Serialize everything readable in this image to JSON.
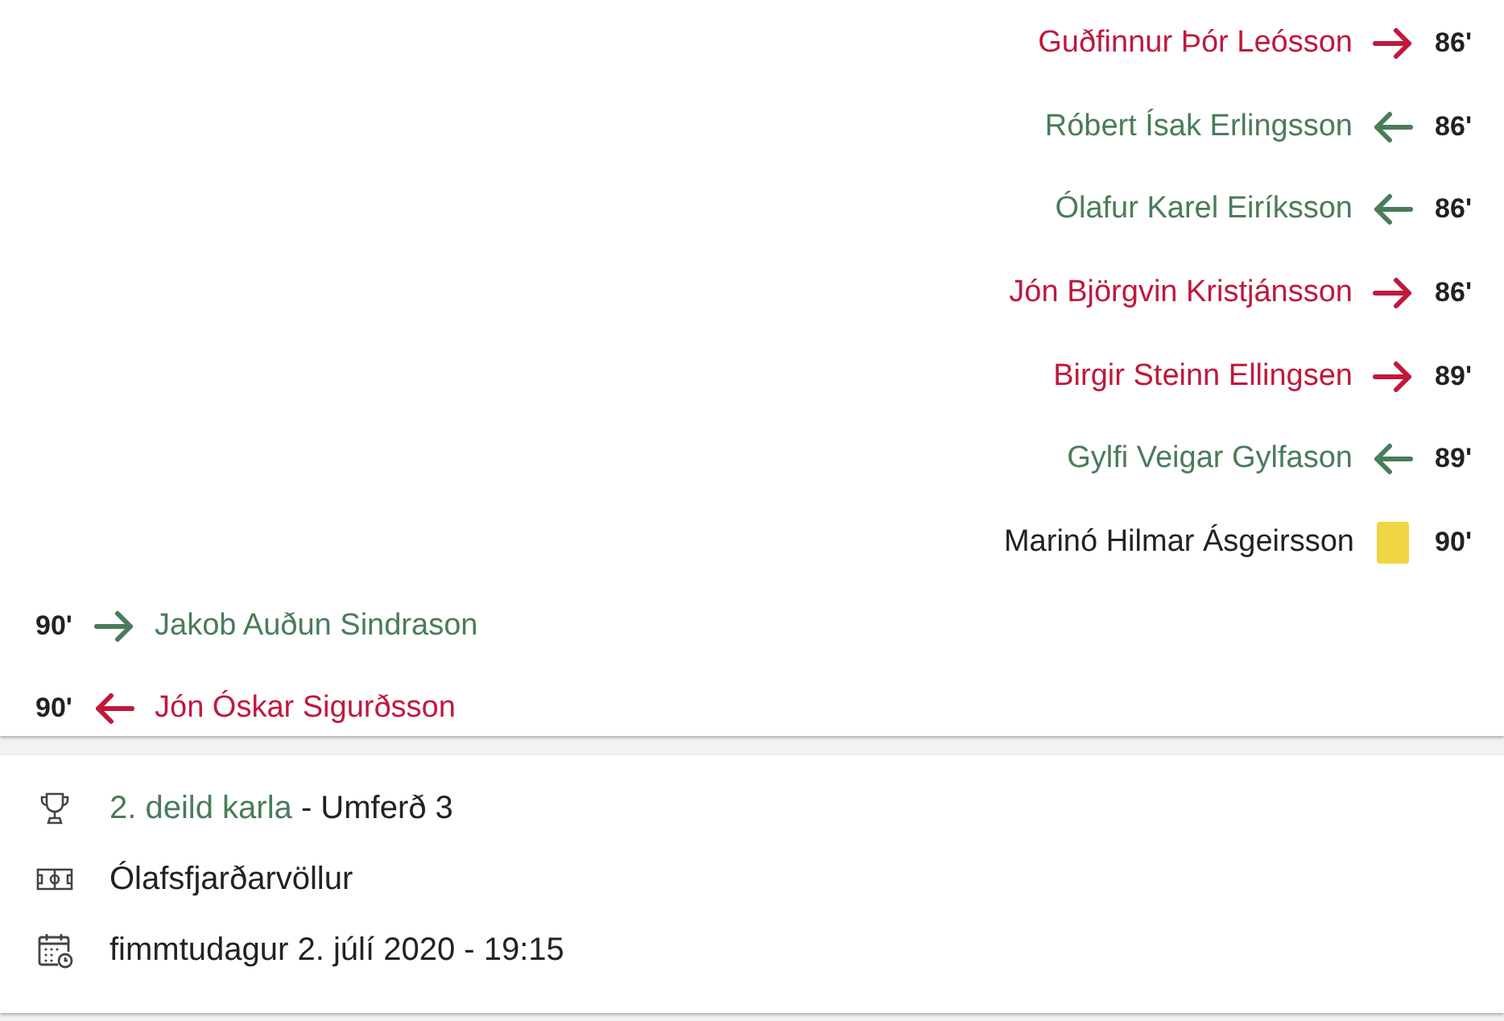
{
  "home_events": [
    {
      "kind": "sub_out",
      "player": "Guðfinnur Þór Leósson",
      "minute": "86'"
    },
    {
      "kind": "sub_in",
      "player": "Róbert Ísak Erlingsson",
      "minute": "86'"
    },
    {
      "kind": "sub_in",
      "player": "Ólafur Karel Eiríksson",
      "minute": "86'"
    },
    {
      "kind": "sub_out",
      "player": "Jón Björgvin Kristjánsson",
      "minute": "86'"
    },
    {
      "kind": "sub_out",
      "player": "Birgir Steinn Ellingsen",
      "minute": "89'"
    },
    {
      "kind": "sub_in",
      "player": "Gylfi Veigar Gylfason",
      "minute": "89'"
    },
    {
      "kind": "yellow_card",
      "player": "Marinó Hilmar Ásgeirsson",
      "minute": "90'"
    }
  ],
  "away_events": [
    {
      "kind": "sub_in",
      "player": "Jakob Auðun Sindrason",
      "minute": "90'"
    },
    {
      "kind": "sub_out",
      "player": "Jón Óskar Sigurðsson",
      "minute": "90'"
    }
  ],
  "info": {
    "competition": "2. deild karla",
    "round": "- Umferð 3",
    "venue": "Ólafsfjarðarvöllur",
    "datetime": "fimmtudagur 2. júlí 2020 - 19:15"
  }
}
